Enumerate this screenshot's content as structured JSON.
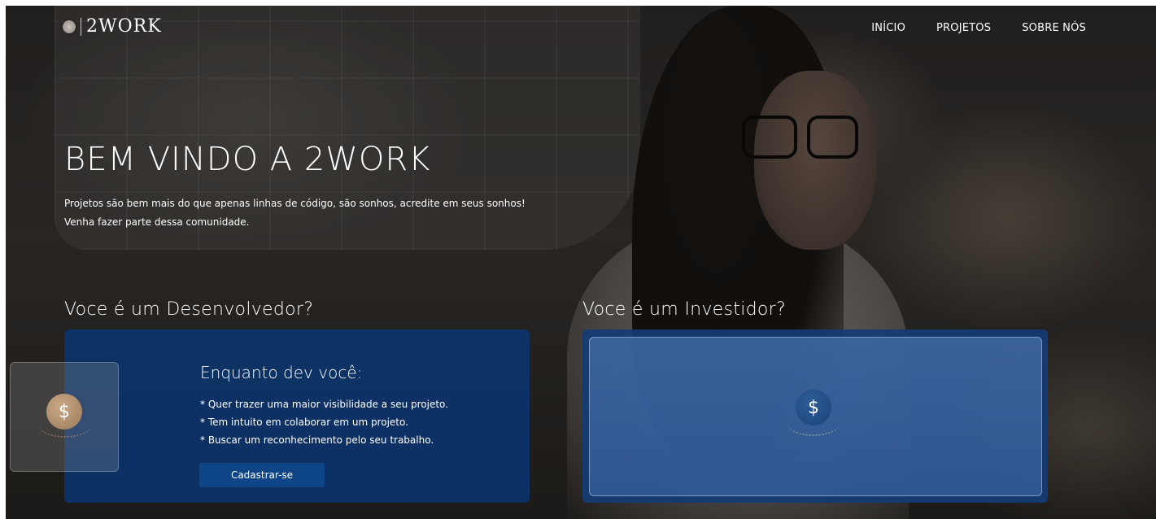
{
  "brand": {
    "name": "2WORK"
  },
  "nav": {
    "items": [
      "INÍCIO",
      "PROJETOS",
      "SOBRE NÓS"
    ]
  },
  "hero": {
    "title": "BEM VINDO A 2WORK",
    "subtitle_line1": "Projetos são bem mais do que apenas linhas de código, são sonhos, acredite em seus sonhos!",
    "subtitle_line2": "Venha fazer parte dessa comunidade."
  },
  "developer": {
    "section_title": "Voce é um Desenvolvedor?",
    "card_heading": "Enquanto dev você:",
    "bullets": [
      "* Quer trazer uma maior visibilidade a seu projeto.",
      "* Tem intuito em colaborar em um projeto.",
      "* Buscar um reconhecimento pelo seu trabalho."
    ],
    "cta_label": "Cadastrar-se",
    "icon_symbol": "$"
  },
  "investor": {
    "section_title": "Voce é um Investidor?",
    "icon_symbol": "$"
  },
  "colors": {
    "card_blue": "#0a346e",
    "button_blue": "#0e4587",
    "coin_gold": "#9c7b5c",
    "coin_blue": "#1b4478",
    "text": "#ffffff"
  },
  "icons": {
    "logo_icon": "coin-icon",
    "card_icon": "dollar-coin-icon"
  }
}
